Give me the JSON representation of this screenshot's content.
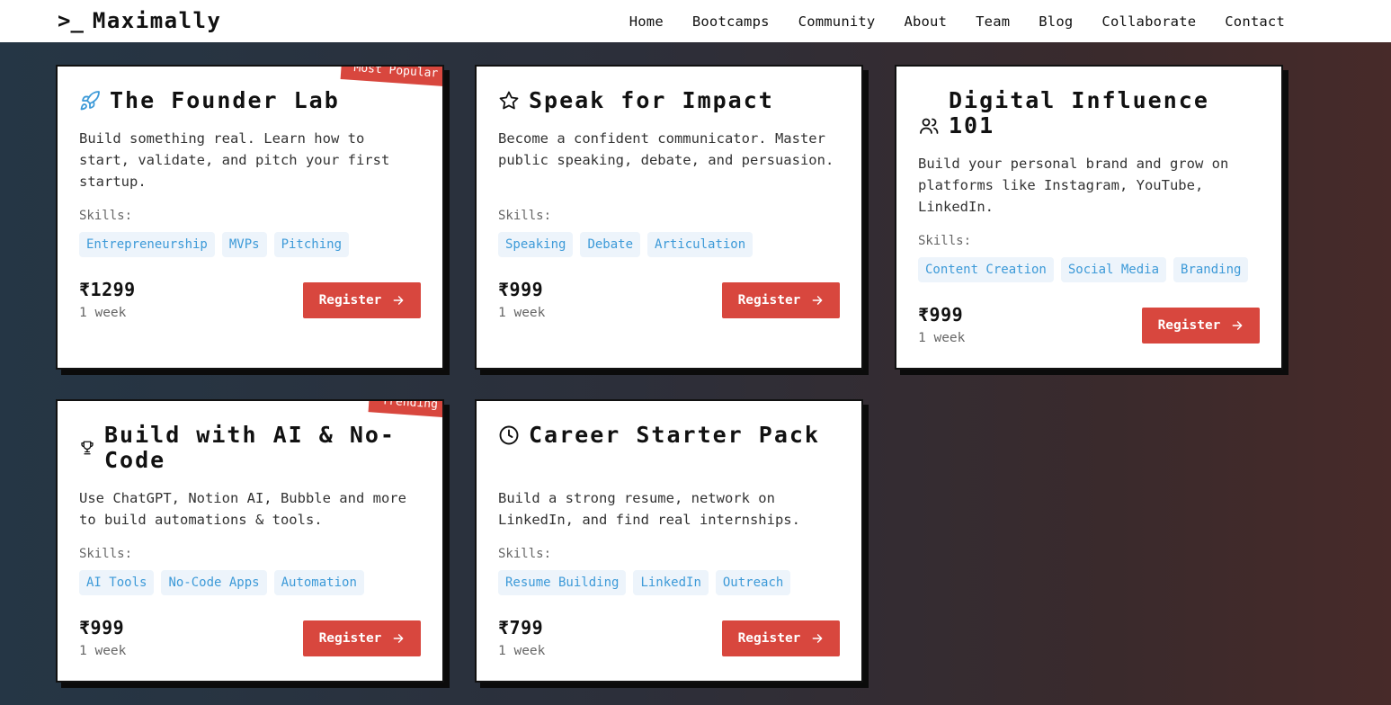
{
  "header": {
    "logo_prompt": ">_",
    "logo_name": "Maximally",
    "nav": [
      "Home",
      "Bootcamps",
      "Community",
      "About",
      "Team",
      "Blog",
      "Collaborate",
      "Contact"
    ]
  },
  "skills_label": "Skills:",
  "register_label": "Register",
  "colors": {
    "accent": "#d8473e",
    "chip_bg": "#edf4fb",
    "chip_text": "#3d9ad8"
  },
  "cards": [
    {
      "title": "The Founder Lab",
      "icon": "rocket-icon",
      "badge": "Most Popular",
      "description": "Build something real. Learn how to start, validate, and pitch your first startup.",
      "skills": [
        "Entrepreneurship",
        "MVPs",
        "Pitching"
      ],
      "price": "₹1299",
      "duration": "1 week"
    },
    {
      "title": "Speak for Impact",
      "icon": "star-icon",
      "badge": "",
      "description": "Become a confident communicator. Master public speaking, debate, and persuasion.",
      "skills": [
        "Speaking",
        "Debate",
        "Articulation"
      ],
      "price": "₹999",
      "duration": "1 week"
    },
    {
      "title": "Digital Influence 101",
      "icon": "users-icon",
      "badge": "",
      "description": "Build your personal brand and grow on platforms like Instagram, YouTube, LinkedIn.",
      "skills": [
        "Content Creation",
        "Social Media",
        "Branding"
      ],
      "price": "₹999",
      "duration": "1 week"
    },
    {
      "title": "Build with AI & No-Code",
      "icon": "trophy-icon",
      "badge": "Trending",
      "description": "Use ChatGPT, Notion AI, Bubble and more to build automations & tools.",
      "skills": [
        "AI Tools",
        "No-Code Apps",
        "Automation"
      ],
      "price": "₹999",
      "duration": "1 week"
    },
    {
      "title": "Career Starter Pack",
      "icon": "clock-icon",
      "badge": "",
      "description": "Build a strong resume, network on LinkedIn, and find real internships.",
      "skills": [
        "Resume Building",
        "LinkedIn",
        "Outreach"
      ],
      "price": "₹799",
      "duration": "1 week"
    }
  ]
}
